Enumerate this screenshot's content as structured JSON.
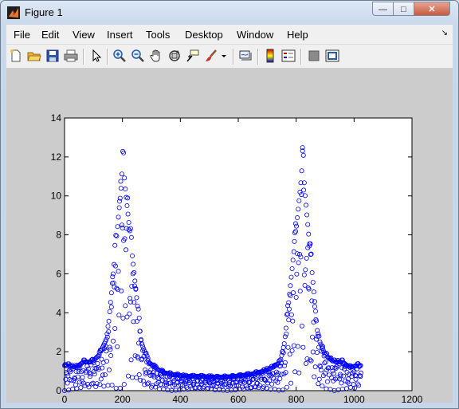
{
  "window": {
    "title": "Figure 1",
    "buttons": {
      "minimize": "—",
      "maximize": "□",
      "close": "✕"
    }
  },
  "menu": {
    "items": [
      "File",
      "Edit",
      "View",
      "Insert",
      "Tools",
      "Desktop",
      "Window",
      "Help"
    ],
    "arrow": "↘"
  },
  "toolbar": {
    "icons": [
      "new-figure-icon",
      "open-file-icon",
      "save-icon",
      "print-icon",
      "edit-plot-arrow-icon",
      "zoom-in-icon",
      "zoom-out-icon",
      "pan-hand-icon",
      "rotate-3d-icon",
      "data-cursor-icon",
      "brush-icon",
      "brush-dropdown-icon",
      "link-plot-icon",
      "insert-colorbar-icon",
      "insert-legend-icon",
      "hide-plot-tools-icon",
      "show-plot-tools-icon"
    ]
  },
  "colors": {
    "series": "#0000ff",
    "figure_bg": "#cccccc",
    "axes_bg": "#ffffff"
  },
  "chart_data": {
    "type": "scatter",
    "marker": "circle-open",
    "xlim": [
      0,
      1200
    ],
    "ylim": [
      0,
      14
    ],
    "xticks": [
      0,
      200,
      400,
      600,
      800,
      1000,
      1200
    ],
    "yticks": [
      0,
      2,
      4,
      6,
      8,
      10,
      12,
      14
    ],
    "series": [
      {
        "color": "#0000ff",
        "x_range": [
          0,
          1024
        ],
        "description_points": [
          [
            15,
            1.4
          ],
          [
            40,
            1.3
          ],
          [
            65,
            1.6
          ],
          [
            95,
            1.6
          ],
          [
            120,
            2.0
          ],
          [
            148,
            3.0
          ],
          [
            202,
            12.5
          ],
          [
            265,
            2.7
          ],
          [
            290,
            1.6
          ],
          [
            320,
            1.2
          ],
          [
            345,
            1.0
          ],
          [
            375,
            0.9
          ],
          [
            420,
            0.8
          ],
          [
            470,
            0.8
          ],
          [
            530,
            0.75
          ],
          [
            590,
            0.8
          ],
          [
            640,
            0.9
          ],
          [
            690,
            1.1
          ],
          [
            720,
            1.3
          ],
          [
            745,
            1.6
          ],
          [
            760,
            2.7
          ],
          [
            822,
            12.5
          ],
          [
            875,
            3.0
          ],
          [
            900,
            2.0
          ],
          [
            930,
            1.6
          ],
          [
            960,
            1.6
          ],
          [
            985,
            1.3
          ],
          [
            1010,
            1.4
          ]
        ]
      }
    ]
  }
}
